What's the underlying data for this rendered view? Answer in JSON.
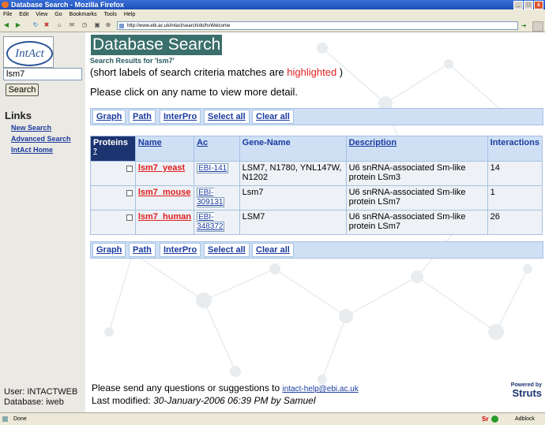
{
  "window": {
    "title": "Database Search - Mozilla Firefox"
  },
  "menu": [
    "File",
    "Edit",
    "View",
    "Go",
    "Bookmarks",
    "Tools",
    "Help"
  ],
  "url": "http://www.ebi.ac.uk/intact/search/do/hvWelcome",
  "sidebar": {
    "logo_text": "IntAct",
    "search_value": "lsm7",
    "search_button": "Search",
    "links_heading": "Links",
    "links": [
      "New Search",
      "Advanced Search",
      "IntAct Home"
    ],
    "user_line": "User: INTACTWEB",
    "db_line": "Database: iweb"
  },
  "main": {
    "title": "Database Search",
    "subhead": "Search Results for 'lsm7'",
    "note_pre": "(short labels of search criteria matches are",
    "note_hl": "highlighted",
    "note_post": ")",
    "instruction": "Please click on any name to view more detail."
  },
  "actions": [
    "Graph",
    "Path",
    "InterPro",
    "Select all",
    "Clear all"
  ],
  "table": {
    "headers": [
      "Proteins",
      "?",
      "Name",
      "Ac",
      "Gene-Name",
      "Description",
      "Interactions"
    ],
    "rows": [
      {
        "name": "lsm7_yeast",
        "ac": "EBI-141",
        "gene": "LSM7, N1780, YNL147W, N1202",
        "desc": "U6 snRNA-associated Sm-like protein LSm3",
        "interactions": "14"
      },
      {
        "name": "lsm7_mouse",
        "ac": "EBI-309131",
        "gene": "Lsm7",
        "desc": "U6 snRNA-associated Sm-like protein LSm7",
        "interactions": "1"
      },
      {
        "name": "lsm7_human",
        "ac": "EBI-348372",
        "gene": "LSM7",
        "desc": "U6 snRNA-associated Sm-like protein LSm7",
        "interactions": "26"
      }
    ]
  },
  "footer": {
    "line1": "Please send any questions or suggestions to",
    "email": "intact-help@ebi.ac.uk",
    "line2_pre": "Last modified:",
    "line2_it": "30-January-2006 06:39 PM by Samuel",
    "powered": "Powered by",
    "struts": "Struts"
  },
  "status": {
    "text": "Done",
    "addon": "Adblock",
    "sr": "Sr"
  }
}
